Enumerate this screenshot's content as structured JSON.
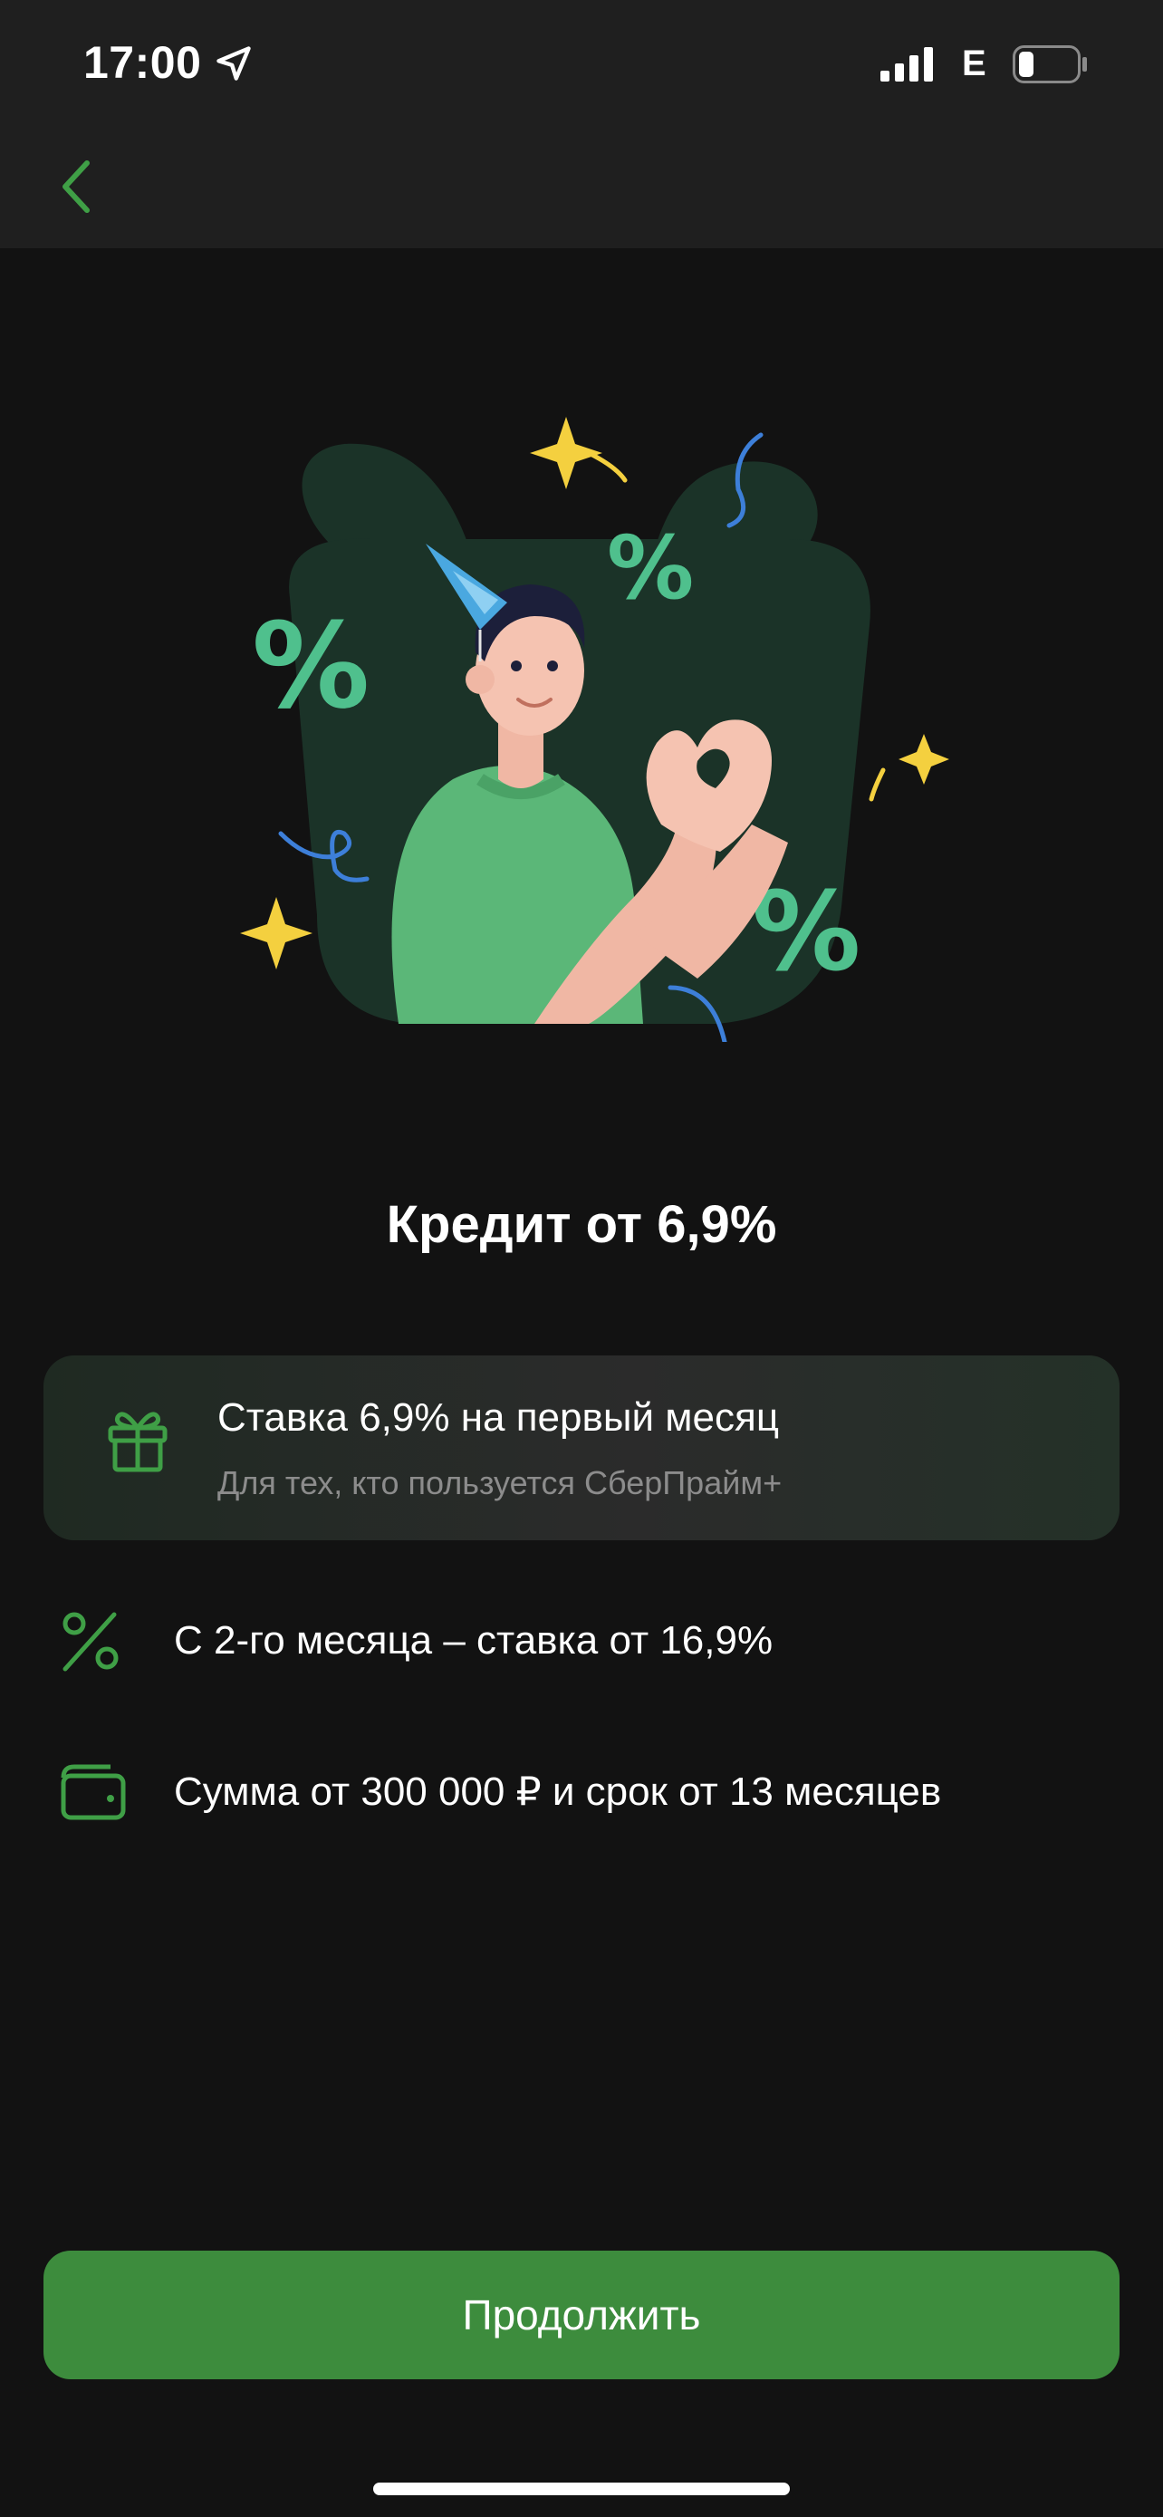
{
  "status_bar": {
    "time": "17:00",
    "network": "E",
    "battery_level": 0.25
  },
  "nav": {
    "back_icon": "chevron-left-icon"
  },
  "hero": {
    "illustration": "celebrating-person-gift-illustration",
    "title": "Кредит от 6,9%"
  },
  "promo_card": {
    "icon": "gift-icon",
    "title": "Ставка 6,9% на первый месяц",
    "subtitle": "Для тех, кто пользуется СберПрайм+"
  },
  "features": [
    {
      "icon": "percent-icon",
      "text": "С 2-го месяца – ставка от 16,9%"
    },
    {
      "icon": "wallet-icon",
      "text": "Сумма от 300 000 ₽ и срок от 13 месяцев"
    }
  ],
  "actions": {
    "continue_label": "Продолжить"
  },
  "colors": {
    "accent": "#3d8c3d",
    "icon_green": "#3f9f46",
    "background": "#121212",
    "topbar": "#1f1f1f"
  }
}
